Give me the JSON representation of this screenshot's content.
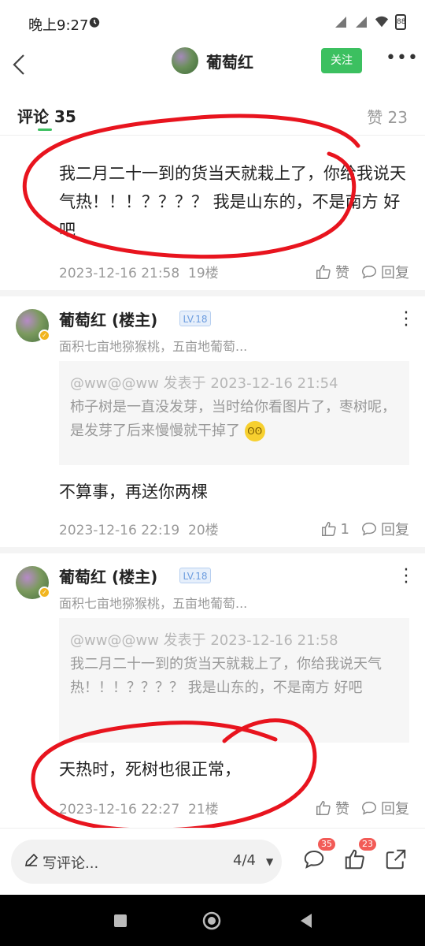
{
  "status_bar": {
    "time": "晚上9:27",
    "battery": "88"
  },
  "nav": {
    "title": "葡萄红",
    "follow_label": "关注",
    "more": "•••"
  },
  "tabs": {
    "comments_label": "评论 35",
    "likes_label": "赞 23"
  },
  "comments": [
    {
      "text": "我二月二十一到的货当天就栽上了，你给我说天气热！！！？？？？ 我是山东的，不是南方 好吧",
      "timestamp": "2023-12-16 21:58",
      "floor": "19楼",
      "like_label": "赞",
      "reply_label": "回复"
    },
    {
      "author": "葡萄红 (楼主)",
      "level": "LV.18",
      "description": "面积七亩地猕猴桃，五亩地葡萄...",
      "quote_head": "@ww@@ww 发表于 2023-12-16 21:54",
      "quote_body": "柿子树是一直没发芽，当时给你看图片了，枣树呢，是发芽了后来慢慢就干掉了",
      "text": "不算事，再送你两棵",
      "timestamp": "2023-12-16 22:19",
      "floor": "20楼",
      "like_count": "1",
      "reply_label": "回复"
    },
    {
      "author": "葡萄红 (楼主)",
      "level": "LV.18",
      "description": "面积七亩地猕猴桃，五亩地葡萄...",
      "quote_head": "@ww@@ww 发表于 2023-12-16 21:58",
      "quote_body": "我二月二十一到的货当天就栽上了，你给我说天气热！！！？？？？ 我是山东的，不是南方 好吧",
      "text": "天热时，死树也很正常，",
      "timestamp": "2023-12-16 22:27",
      "floor": "21楼",
      "like_label": "赞",
      "reply_label": "回复"
    }
  ],
  "bottom_bar": {
    "input_placeholder": "写评论...",
    "page": "4/4",
    "comment_badge": "35",
    "like_badge": "23"
  },
  "colors": {
    "accent_green": "#3cc060",
    "annotation_red": "#e8141e",
    "badge_red": "#f25b57"
  }
}
